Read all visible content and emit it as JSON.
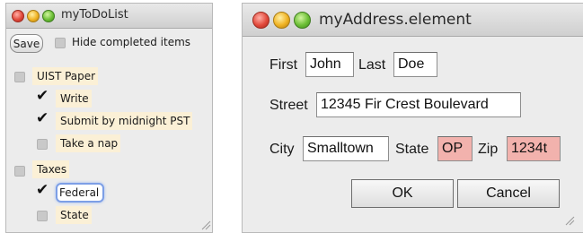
{
  "todo_window": {
    "title": "myToDoList",
    "save_label": "Save",
    "hide_completed_label": "Hide completed items",
    "items": [
      {
        "label": "UIST Paper",
        "checked": false,
        "level": 0
      },
      {
        "label": "Write",
        "checked": true,
        "level": 1
      },
      {
        "label": "Submit by midnight PST",
        "checked": true,
        "level": 1
      },
      {
        "label": "Take a nap",
        "checked": false,
        "level": 1
      },
      {
        "label": "Taxes",
        "checked": false,
        "level": 0
      },
      {
        "label": "Federal",
        "checked": true,
        "level": 1,
        "editing": true
      },
      {
        "label": "State",
        "checked": false,
        "level": 1
      }
    ]
  },
  "address_window": {
    "title": "myAddress.element",
    "first_label": "First",
    "first_value": "John",
    "last_label": "Last",
    "last_value": "Doe",
    "street_label": "Street",
    "street_value": "12345 Fir Crest Boulevard",
    "city_label": "City",
    "city_value": "Smalltown",
    "state_label": "State",
    "state_value": "OP",
    "zip_label": "Zip",
    "zip_value": "1234t",
    "ok_label": "OK",
    "cancel_label": "Cancel"
  },
  "colors": {
    "item_highlight": "#fbf0d6",
    "invalid_field": "#f2b2ad",
    "focus_ring": "#7d9fe6"
  }
}
